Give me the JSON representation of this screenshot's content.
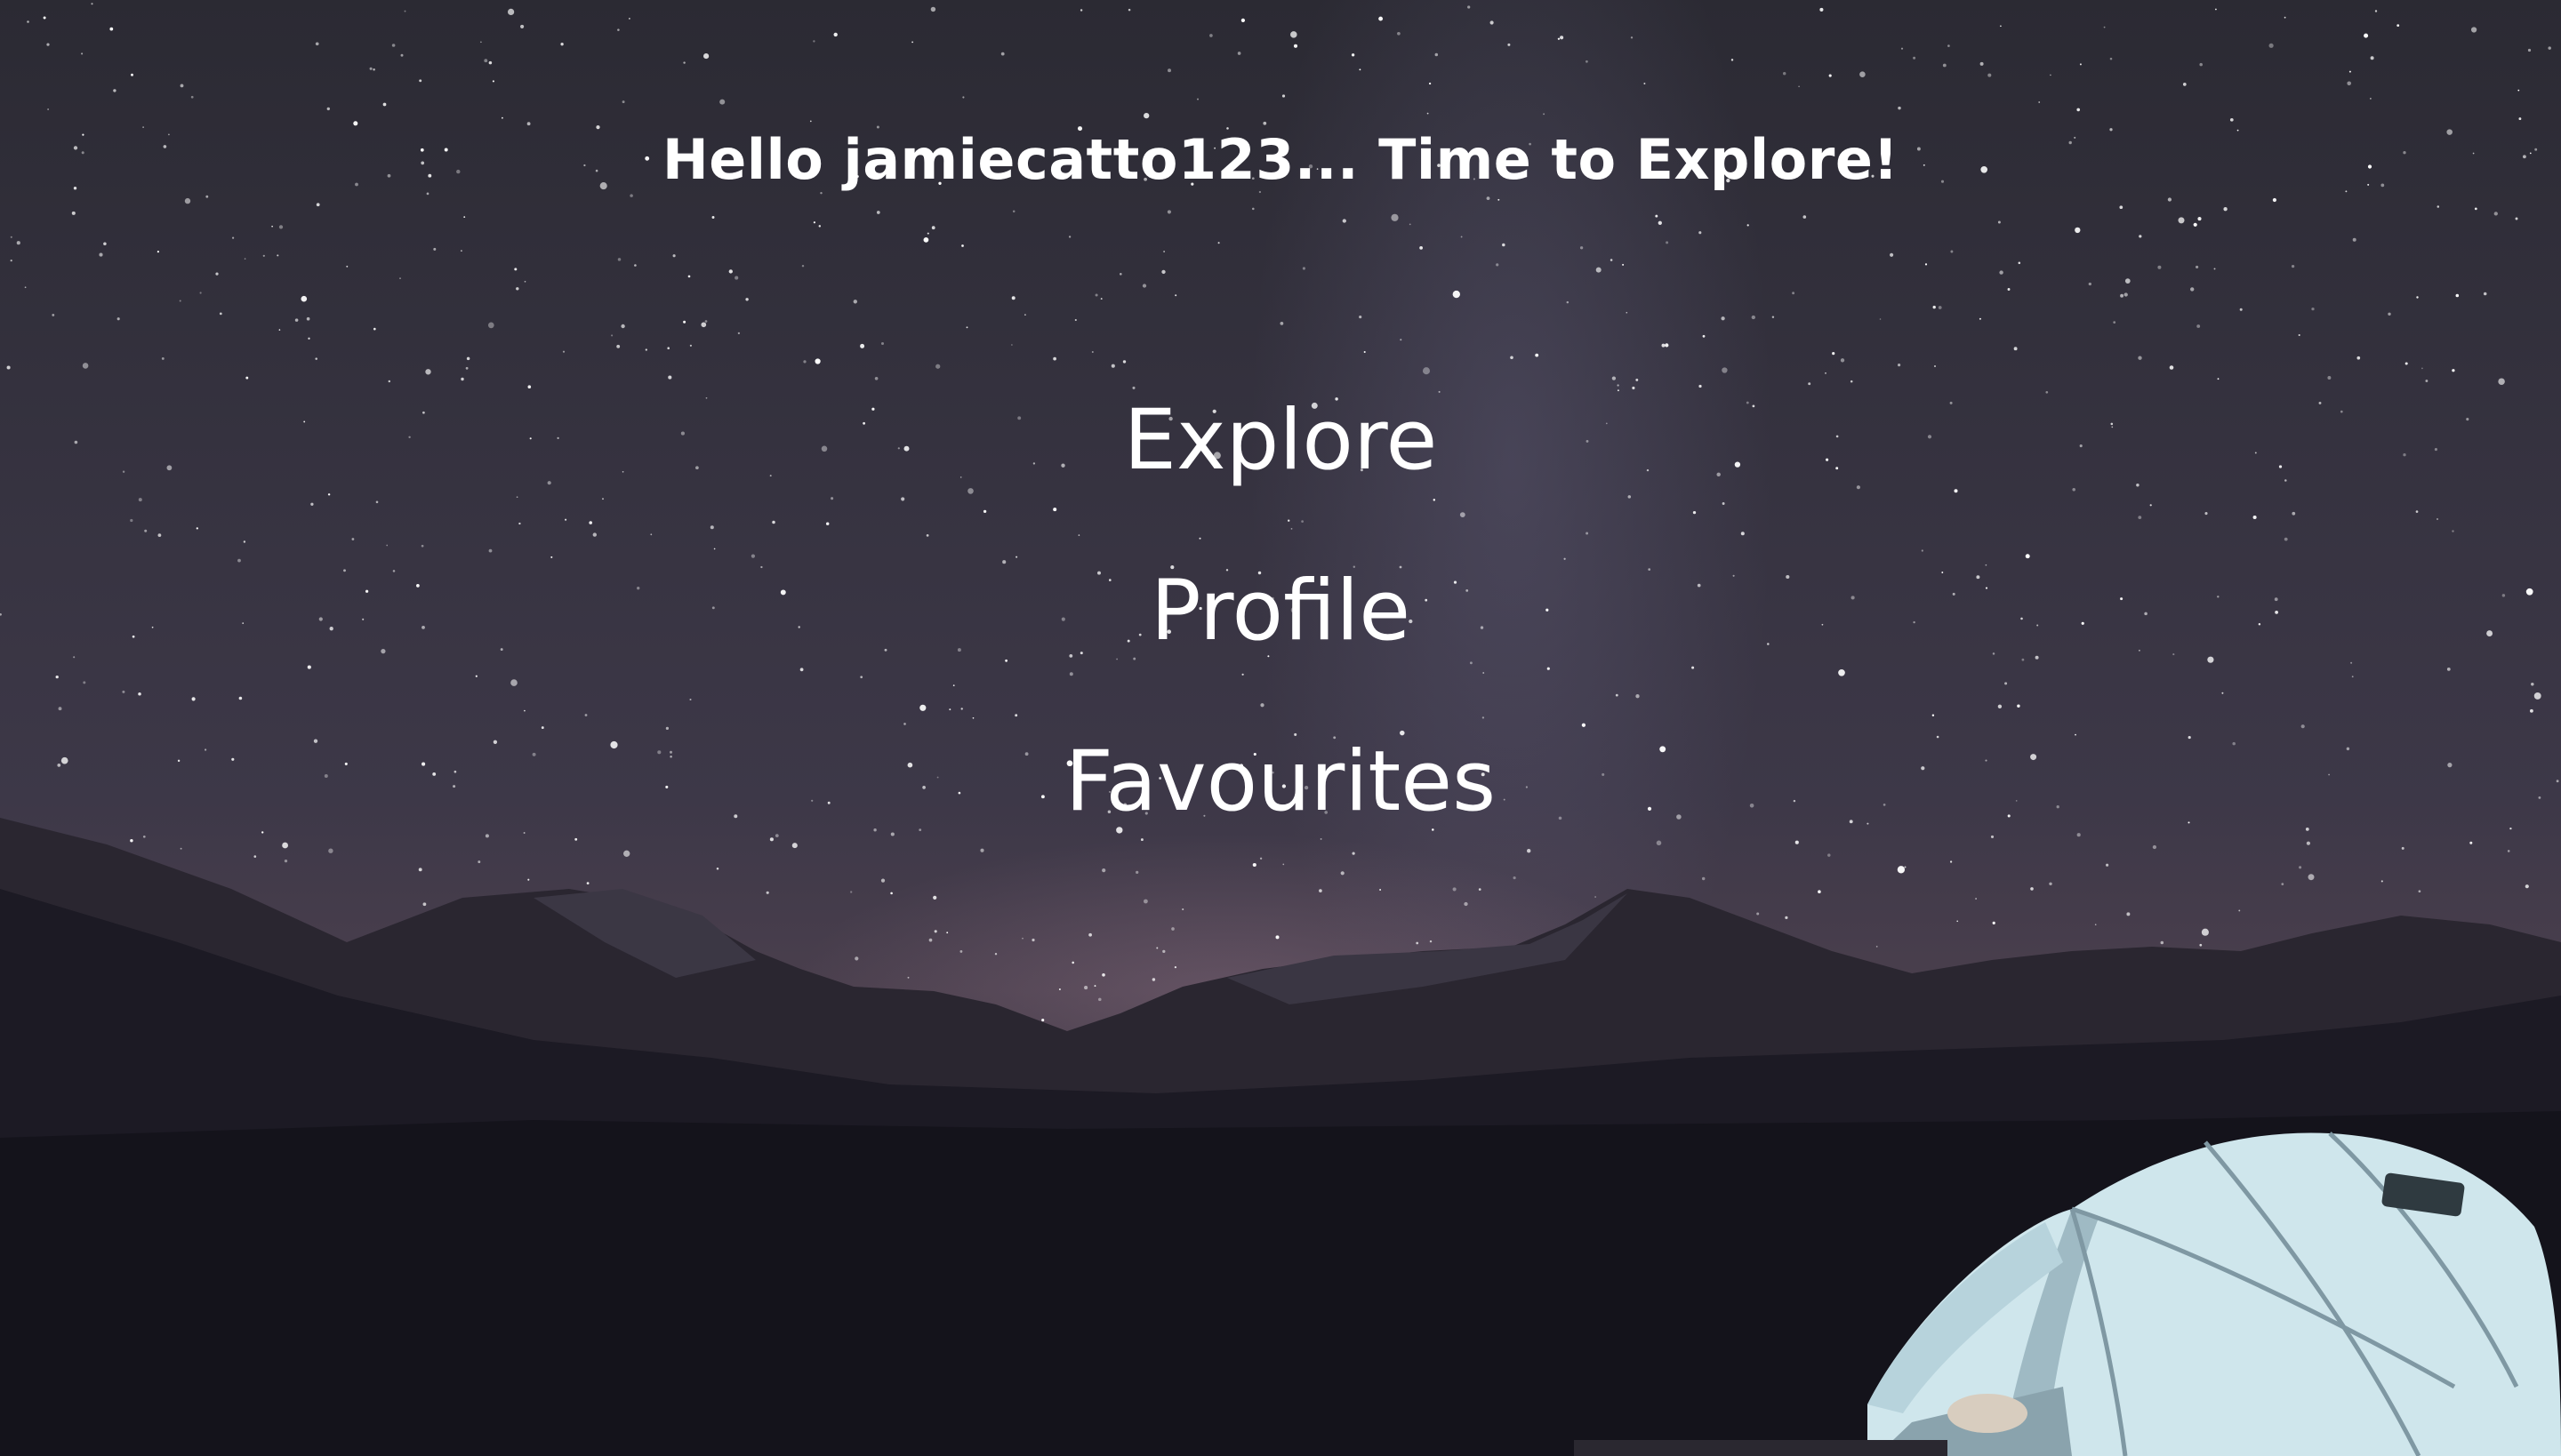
{
  "greeting": {
    "text": "Hello jamiecatto123... Time to Explore!"
  },
  "menu": {
    "items": [
      {
        "label": "Explore"
      },
      {
        "label": "Profile"
      },
      {
        "label": "Favourites"
      }
    ]
  },
  "background": {
    "scene": "night-sky-milky-way-mountains-tent",
    "colors": {
      "sky": "#35323f",
      "mountains": "#1c1a24",
      "ground": "#13121a",
      "tent": "#cfe6ec",
      "text": "#ffffff"
    }
  }
}
